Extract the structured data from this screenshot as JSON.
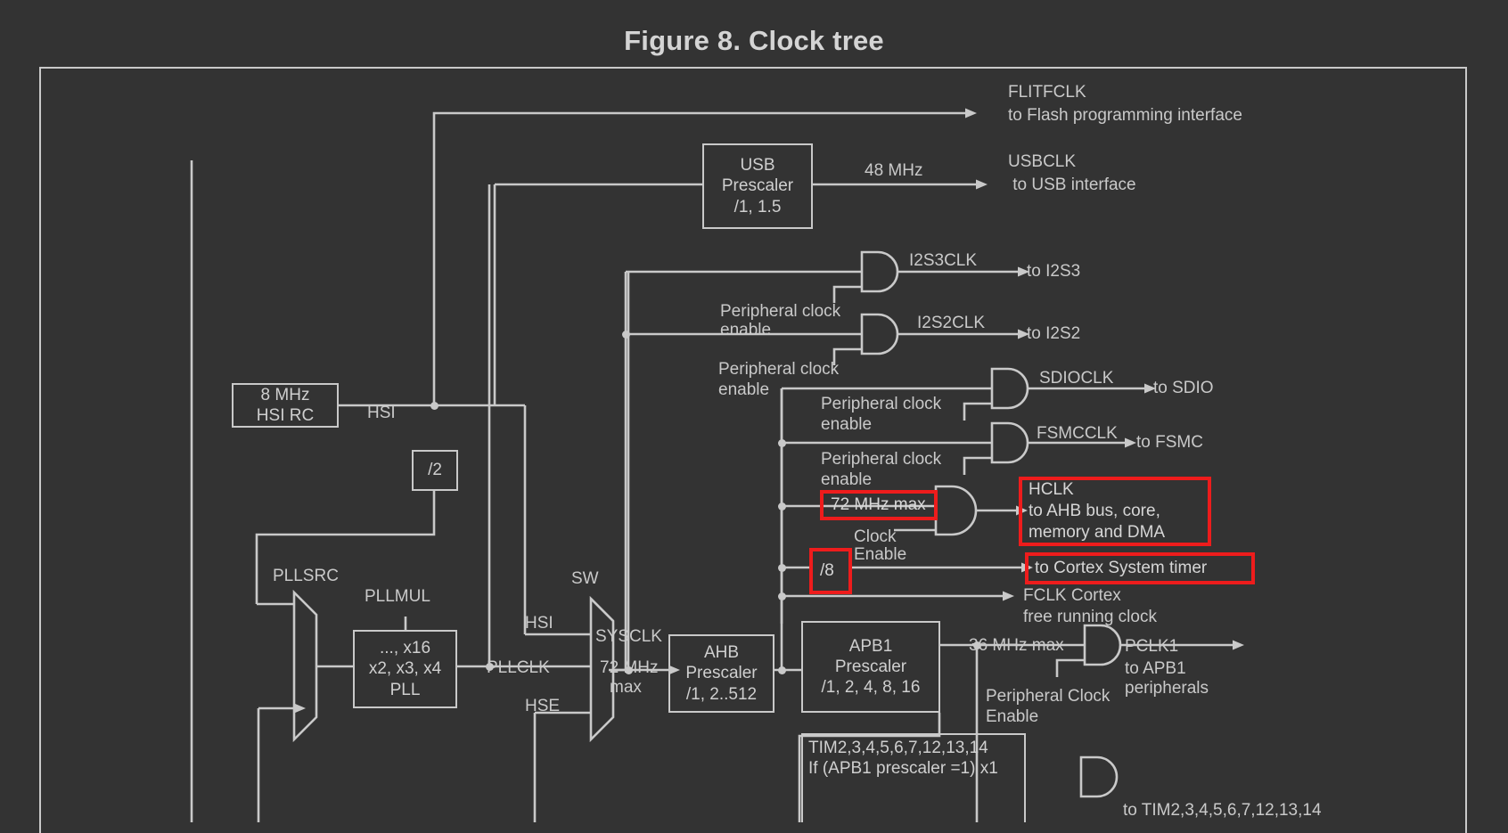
{
  "figure": {
    "title": "Figure 8. Clock tree"
  },
  "sources": {
    "hsi_rc": {
      "line1": "8 MHz",
      "line2": "HSI RC"
    },
    "hsi_label": "HSI",
    "div2": "/2",
    "hse_label": "HSE"
  },
  "pll": {
    "pllsrc_label": "PLLSRC",
    "pllmul_label": "PLLMUL",
    "block_line1": "..., x16",
    "block_line2": "x2, x3, x4",
    "block_line3": "PLL",
    "pllclk_label": "PLLCLK"
  },
  "sw_mux": {
    "label": "SW",
    "input_hsi": "HSI",
    "input_pllclk": "PLLCLK",
    "input_hse": "HSE",
    "output": "SYSCLK",
    "output_note_line1": "72 MHz",
    "output_note_line2": "max"
  },
  "prescalers": {
    "usb": {
      "line1": "USB",
      "line2": "Prescaler",
      "line3": "/1, 1.5"
    },
    "ahb": {
      "line1": "AHB",
      "line2": "Prescaler",
      "line3": "/1, 2..512"
    },
    "apb1": {
      "line1": "APB1",
      "line2": "Prescaler",
      "line3": "/1, 2, 4, 8, 16"
    }
  },
  "outputs": {
    "flitfclk": {
      "name": "FLITFCLK",
      "desc": "to Flash programming interface"
    },
    "usbclk": {
      "freq": "48 MHz",
      "name": "USBCLK",
      "desc": " to USB interface"
    },
    "i2s3clk": {
      "name": "I2S3CLK",
      "desc": "to I2S3"
    },
    "i2s2clk": {
      "name": "I2S2CLK",
      "desc": "to I2S2"
    },
    "sdioclk": {
      "name": "SDIOCLK",
      "desc": "to SDIO"
    },
    "fsmcclk": {
      "name": "FSMCCLK",
      "desc": "to FSMC"
    },
    "fclk": {
      "line1": "FCLK Cortex",
      "line2": "free running clock"
    },
    "pclk1": {
      "line1": "PCLK1",
      "line2": "to APB1",
      "line3": "peripherals"
    },
    "tim_out": "to TIM2,3,4,5,6,7,12,13,14"
  },
  "highlights": {
    "hclk_max": "72 MHz max",
    "div8": "/8",
    "hclk": {
      "line1": "HCLK",
      "line2": "to AHB bus, core,",
      "line3": "memory and DMA"
    },
    "cortex_timer": "to Cortex System timer",
    "accent_color": "#ee1c1c"
  },
  "enable_labels": {
    "i2s3": {
      "line1": "Peripheral clock",
      "line2": "enable"
    },
    "i2s2": {
      "line1": "Peripheral clock",
      "line2": "enable"
    },
    "sdio": {
      "line1": "Peripheral clock",
      "line2": "enable"
    },
    "fsmc": {
      "line1": "Peripheral clock",
      "line2": "enable"
    },
    "hclk": {
      "line1": "Clock",
      "line2": "Enable"
    },
    "apb1": {
      "line1": "Peripheral Clock",
      "line2": "Enable"
    }
  },
  "apb1_branch": {
    "max_freq": "36 MHz max",
    "tim_line1": "TIM2,3,4,5,6,7,12,13,14",
    "tim_line2": "If (APB1 prescaler =1) x1"
  },
  "colors": {
    "background": "#333333",
    "line": "#c9c9c9",
    "text": "#c9c9c9",
    "accent": "#ee1c1c"
  }
}
